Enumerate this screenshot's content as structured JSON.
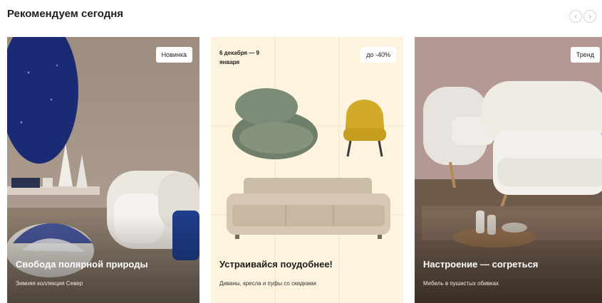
{
  "section": {
    "title": "Рекомендуем сегодня"
  },
  "nav": {
    "prev": "‹",
    "next": "›"
  },
  "cards": [
    {
      "badge": "Новинка",
      "title": "Свобода полярной природы",
      "subtitle": "Зимняя коллекция Север"
    },
    {
      "badge": "до -40%",
      "date_range": "6 декабря — 9 января",
      "title": "Устраивайся поудобнее!",
      "subtitle": "Диваны, кресла и пуфы со скидками"
    },
    {
      "badge": "Тренд",
      "title": "Настроение — согреться",
      "subtitle": "Мебель в пушистых обивках"
    }
  ]
}
